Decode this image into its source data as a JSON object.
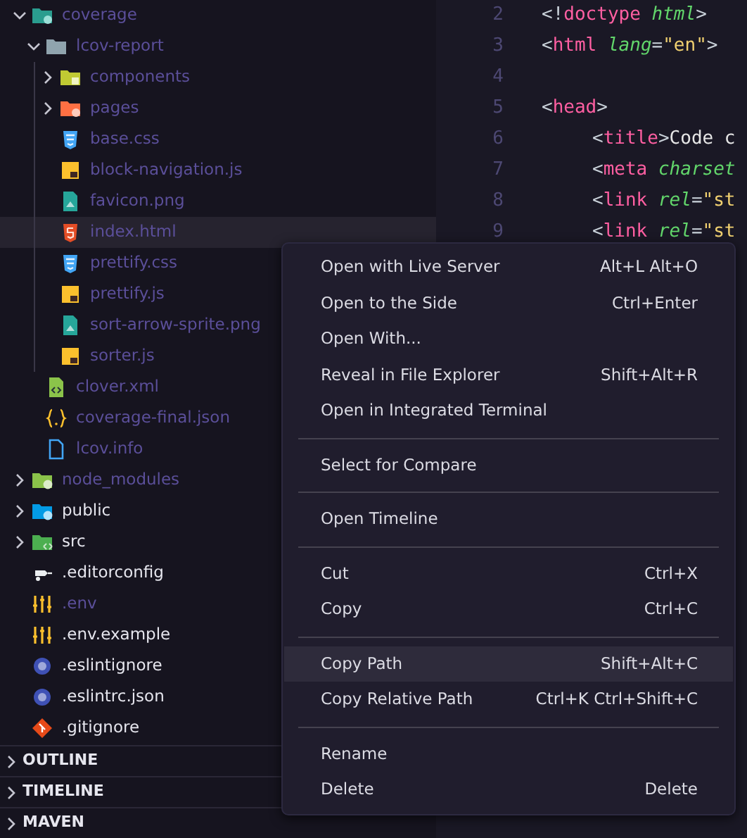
{
  "explorer": {
    "tree": [
      {
        "label": "coverage",
        "kind": "coverage",
        "expanded": true,
        "ignored": true,
        "selected": false,
        "children": [
          {
            "label": "lcov-report",
            "kind": "plain",
            "expanded": true,
            "ignored": true,
            "selected": false,
            "children": [
              {
                "label": "components",
                "kind": "components",
                "expanded": false,
                "ignored": true,
                "selected": false
              },
              {
                "label": "pages",
                "kind": "pages",
                "expanded": false,
                "ignored": true,
                "selected": false
              },
              {
                "label": "base.css",
                "kind": "css",
                "ignored": true,
                "selected": false
              },
              {
                "label": "block-navigation.js",
                "kind": "js",
                "ignored": true,
                "selected": false
              },
              {
                "label": "favicon.png",
                "kind": "image",
                "ignored": true,
                "selected": false
              },
              {
                "label": "index.html",
                "kind": "html",
                "ignored": true,
                "selected": true
              },
              {
                "label": "prettify.css",
                "kind": "css",
                "ignored": true,
                "selected": false
              },
              {
                "label": "prettify.js",
                "kind": "js",
                "ignored": true,
                "selected": false
              },
              {
                "label": "sort-arrow-sprite.png",
                "kind": "image",
                "ignored": true,
                "selected": false
              },
              {
                "label": "sorter.js",
                "kind": "js",
                "ignored": true,
                "selected": false
              }
            ]
          },
          {
            "label": "clover.xml",
            "kind": "xml",
            "ignored": true,
            "selected": false
          },
          {
            "label": "coverage-final.json",
            "kind": "json",
            "ignored": true,
            "selected": false
          },
          {
            "label": "lcov.info",
            "kind": "doc",
            "ignored": true,
            "selected": false
          }
        ]
      },
      {
        "label": "node_modules",
        "kind": "node",
        "expanded": false,
        "ignored": true,
        "selected": false
      },
      {
        "label": "public",
        "kind": "public",
        "expanded": false,
        "ignored": false,
        "selected": false
      },
      {
        "label": "src",
        "kind": "src",
        "expanded": false,
        "ignored": false,
        "selected": false
      },
      {
        "label": ".editorconfig",
        "kind": "editorconfig",
        "ignored": false,
        "selected": false
      },
      {
        "label": ".env",
        "kind": "env",
        "ignored": true,
        "selected": false
      },
      {
        "label": ".env.example",
        "kind": "env",
        "ignored": false,
        "selected": false
      },
      {
        "label": ".eslintignore",
        "kind": "eslint",
        "ignored": false,
        "selected": false
      },
      {
        "label": ".eslintrc.json",
        "kind": "eslint",
        "ignored": false,
        "selected": false
      },
      {
        "label": ".gitignore",
        "kind": "git",
        "ignored": false,
        "selected": false
      }
    ],
    "sections": [
      {
        "label": "OUTLINE",
        "expanded": false
      },
      {
        "label": "TIMELINE",
        "expanded": false
      },
      {
        "label": "MAVEN",
        "expanded": false
      }
    ]
  },
  "editor": {
    "lines": [
      {
        "number": "2",
        "tokens": [
          {
            "text": "<!",
            "kind": "punct"
          },
          {
            "text": "doctype ",
            "kind": "tag"
          },
          {
            "text": "html",
            "kind": "attr"
          },
          {
            "text": ">",
            "kind": "punct"
          }
        ]
      },
      {
        "number": "3",
        "tokens": [
          {
            "text": "<",
            "kind": "punct"
          },
          {
            "text": "html ",
            "kind": "tag"
          },
          {
            "text": "lang",
            "kind": "attr"
          },
          {
            "text": "=",
            "kind": "punct"
          },
          {
            "text": "\"en\"",
            "kind": "string"
          },
          {
            "text": ">",
            "kind": "punct"
          }
        ]
      },
      {
        "number": "4"
      },
      {
        "number": "5",
        "tokens": [
          {
            "text": "<",
            "kind": "punct"
          },
          {
            "text": "head",
            "kind": "tag"
          },
          {
            "text": ">",
            "kind": "punct"
          }
        ]
      },
      {
        "number": "6",
        "indent": true,
        "tokens": [
          {
            "text": "<",
            "kind": "punct"
          },
          {
            "text": "title",
            "kind": "tag"
          },
          {
            "text": ">",
            "kind": "punct"
          },
          {
            "text": "Code c",
            "kind": "text"
          }
        ]
      },
      {
        "number": "7",
        "indent": true,
        "tokens": [
          {
            "text": "<",
            "kind": "punct"
          },
          {
            "text": "meta ",
            "kind": "tag"
          },
          {
            "text": "charset",
            "kind": "attr"
          }
        ]
      },
      {
        "number": "8",
        "indent": true,
        "tokens": [
          {
            "text": "<",
            "kind": "punct"
          },
          {
            "text": "link ",
            "kind": "tag"
          },
          {
            "text": "rel",
            "kind": "attr"
          },
          {
            "text": "=",
            "kind": "punct"
          },
          {
            "text": "\"st",
            "kind": "string"
          }
        ]
      },
      {
        "number": "9",
        "indent": true,
        "tokens": [
          {
            "text": "<",
            "kind": "punct"
          },
          {
            "text": "link ",
            "kind": "tag"
          },
          {
            "text": "rel",
            "kind": "attr"
          },
          {
            "text": "=",
            "kind": "punct"
          },
          {
            "text": "\"st",
            "kind": "string"
          }
        ]
      }
    ]
  },
  "context_menu": {
    "groups": [
      [
        {
          "label": "Open with Live Server",
          "shortcut": "Alt+L Alt+O",
          "selected": false
        },
        {
          "label": "Open to the Side",
          "shortcut": "Ctrl+Enter",
          "selected": false
        },
        {
          "label": "Open With...",
          "selected": false
        },
        {
          "label": "Reveal in File Explorer",
          "shortcut": "Shift+Alt+R",
          "selected": false
        },
        {
          "label": "Open in Integrated Terminal",
          "selected": false
        }
      ],
      [
        {
          "label": "Select for Compare",
          "selected": false
        }
      ],
      [
        {
          "label": "Open Timeline",
          "selected": false
        }
      ],
      [
        {
          "label": "Cut",
          "shortcut": "Ctrl+X",
          "selected": false
        },
        {
          "label": "Copy",
          "shortcut": "Ctrl+C",
          "selected": false
        }
      ],
      [
        {
          "label": "Copy Path",
          "shortcut": "Shift+Alt+C",
          "selected": true
        },
        {
          "label": "Copy Relative Path",
          "shortcut": "Ctrl+K Ctrl+Shift+C",
          "selected": false
        }
      ],
      [
        {
          "label": "Rename",
          "selected": false
        },
        {
          "label": "Delete",
          "shortcut": "Delete",
          "selected": false
        }
      ]
    ]
  }
}
